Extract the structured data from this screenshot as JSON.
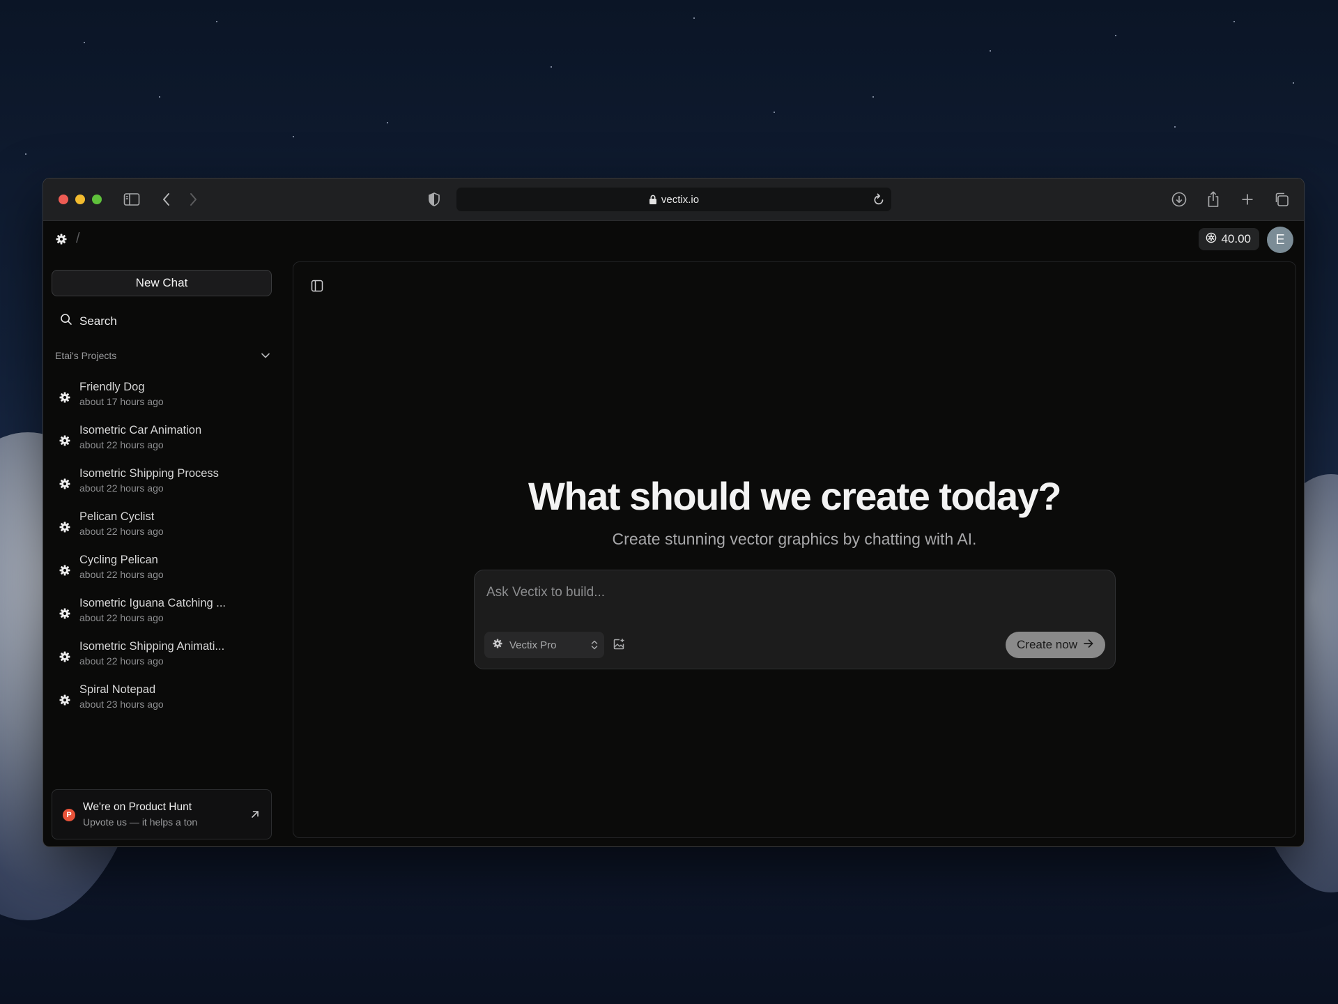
{
  "browser": {
    "url": "vectix.io"
  },
  "app": {
    "breadcrumb_sep": "/",
    "credits": "40.00",
    "avatar_initial": "E"
  },
  "sidebar": {
    "new_chat_label": "New Chat",
    "search_label": "Search",
    "projects_header": "Etai's Projects",
    "projects": [
      {
        "title": "Friendly Dog",
        "time": "about 17 hours ago"
      },
      {
        "title": "Isometric Car Animation",
        "time": "about 22 hours ago"
      },
      {
        "title": "Isometric Shipping Process",
        "time": "about 22 hours ago"
      },
      {
        "title": "Pelican Cyclist",
        "time": "about 22 hours ago"
      },
      {
        "title": "Cycling Pelican",
        "time": "about 22 hours ago"
      },
      {
        "title": "Isometric Iguana Catching ...",
        "time": "about 22 hours ago"
      },
      {
        "title": "Isometric Shipping Animati...",
        "time": "about 22 hours ago"
      },
      {
        "title": "Spiral Notepad",
        "time": "about 23 hours ago"
      }
    ],
    "product_hunt": {
      "badge": "P",
      "title": "We're on Product Hunt",
      "subtitle": "Upvote us — it helps a ton"
    }
  },
  "main": {
    "headline": "What should we create today?",
    "subheadline": "Create stunning vector graphics by chatting with AI.",
    "composer": {
      "placeholder": "Ask Vectix to build...",
      "value": "",
      "model": "Vectix Pro",
      "submit_label": "Create now"
    }
  },
  "colors": {
    "traffic_red": "#ee5c54",
    "traffic_yellow": "#f2bb2f",
    "traffic_green": "#5fc13b",
    "product_hunt": "#e8533a",
    "submit_button": "#8a8a8a",
    "avatar": "#7b8c96"
  },
  "icons": {
    "sidebar_toggle": "sidebar-icon",
    "back": "chevron-left-icon",
    "forward": "chevron-right-icon",
    "privacy": "shield-icon",
    "lock": "lock-icon",
    "reload": "reload-icon",
    "download": "download-icon",
    "share": "share-icon",
    "new_tab": "plus-icon",
    "tabs": "tabs-overview-icon",
    "logo": "gear-icon",
    "credits": "coin-icon",
    "search": "search-icon",
    "collapse": "chevron-down-icon",
    "project": "gear-icon",
    "external": "arrow-up-right-icon",
    "attach": "image-add-icon",
    "submit": "arrow-right-icon"
  }
}
